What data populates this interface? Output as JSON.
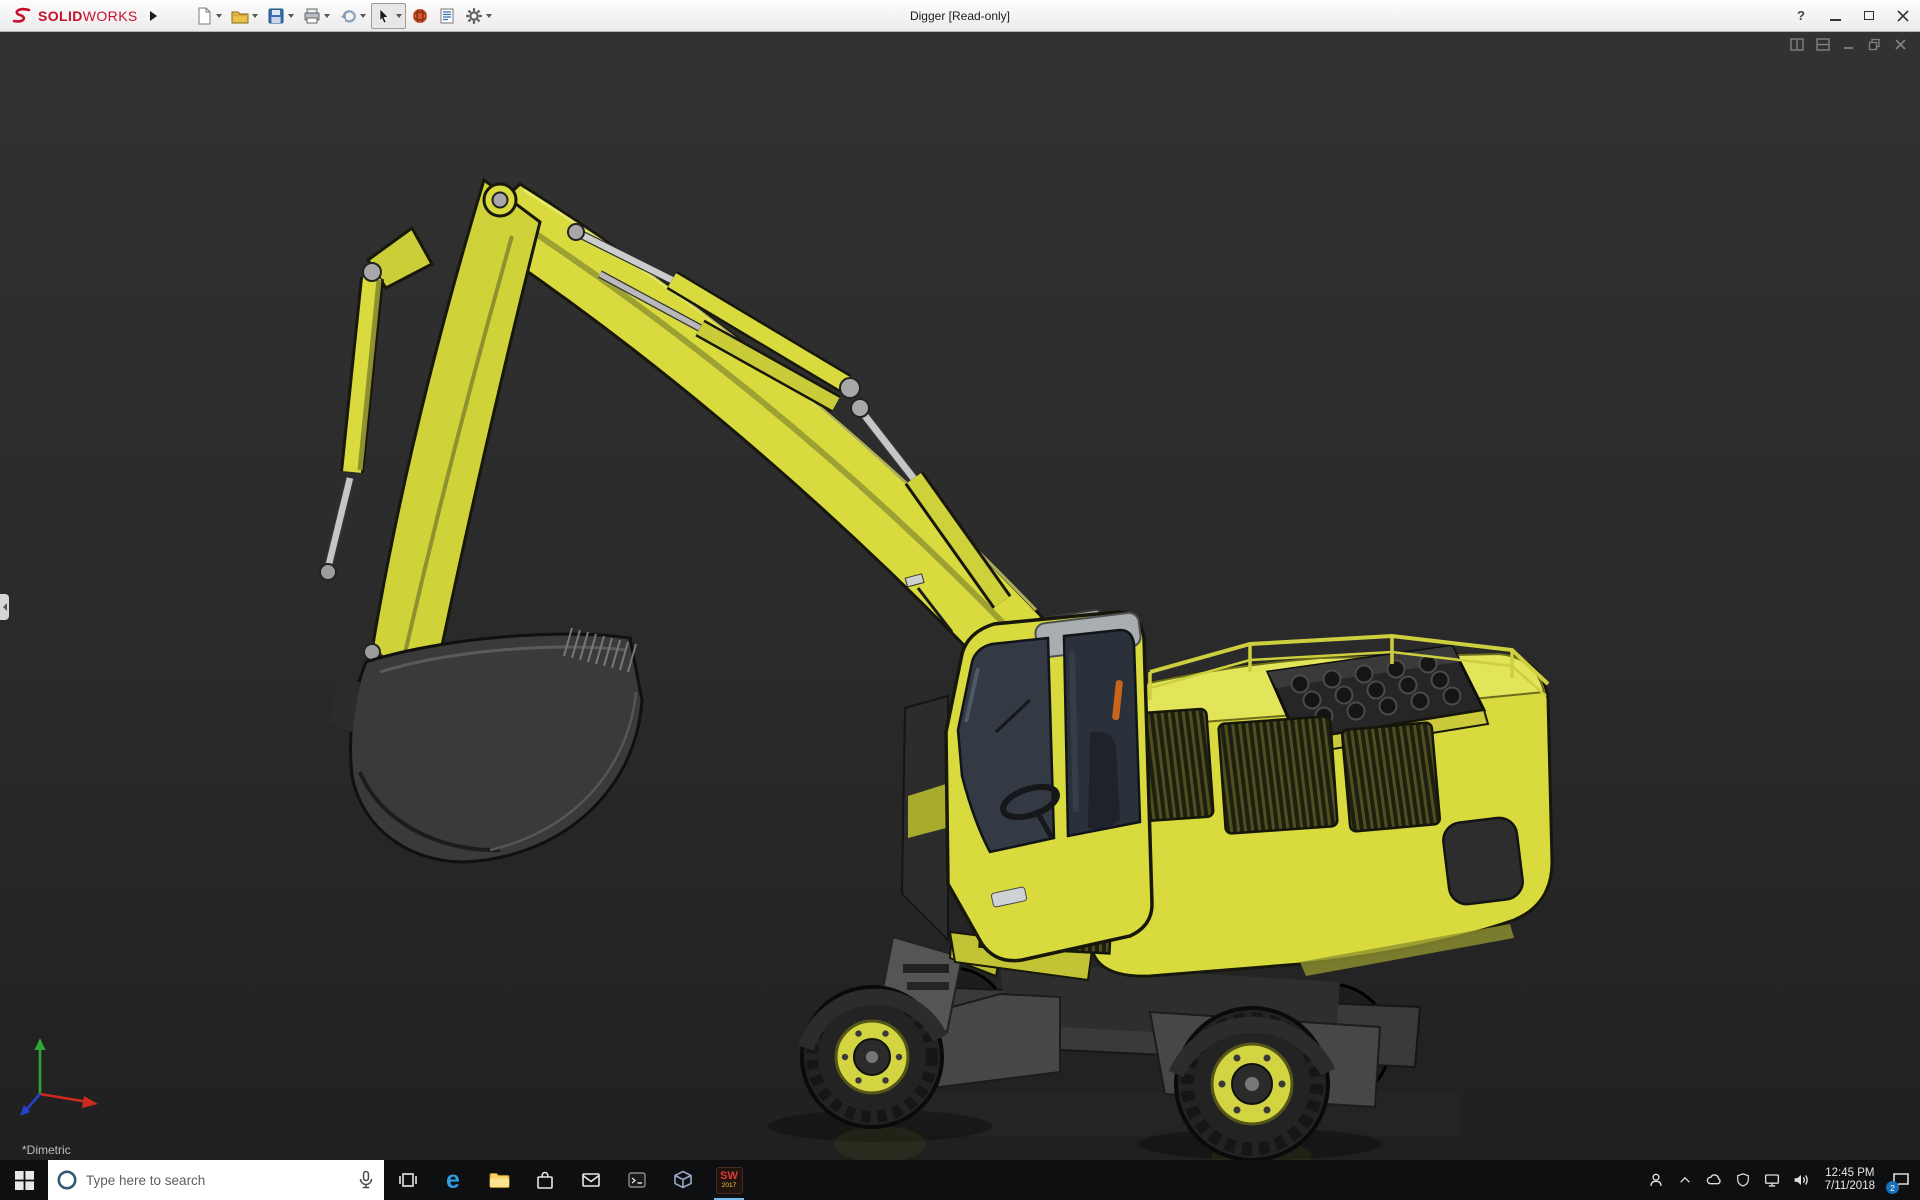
{
  "titlebar": {
    "brand": {
      "name_bold": "SOLID",
      "name_light": "WORKS"
    },
    "document_title": "Digger [Read-only]",
    "help_glyph": "?",
    "toolbar_items": [
      {
        "name": "new-document",
        "dropdown": true
      },
      {
        "name": "open",
        "dropdown": true
      },
      {
        "name": "save",
        "dropdown": true
      },
      {
        "name": "print",
        "dropdown": true
      },
      {
        "name": "undo",
        "dropdown": true
      },
      {
        "name": "select",
        "dropdown": true,
        "active": true
      },
      {
        "name": "rebuild",
        "dropdown": false
      },
      {
        "name": "file-properties",
        "dropdown": false
      },
      {
        "name": "options",
        "dropdown": true
      }
    ],
    "window_controls": [
      "help",
      "minimize",
      "maximize",
      "close"
    ]
  },
  "viewport": {
    "view_orientation_label": "*Dimetric",
    "background_color": "#2a2a2a",
    "document_controls": [
      "pane-split-vertical",
      "pane-split-horizontal",
      "doc-minimize",
      "doc-restore",
      "doc-close"
    ],
    "triad_axes": [
      "x-red",
      "y-green",
      "z-blue"
    ],
    "model": {
      "name": "Digger excavator",
      "primary_color": "#d8da3d",
      "dark_color": "#2e2e2e",
      "metal_color": "#b9b9b9",
      "accent_color": "#c8651b",
      "visible_parts": [
        "boom",
        "stick",
        "bucket",
        "hydraulic-cylinders",
        "cab",
        "upper-body",
        "engine-block",
        "side-grilles",
        "handrails",
        "undercarriage",
        "wheels"
      ]
    }
  },
  "taskbar": {
    "search": {
      "placeholder": "Type here to search"
    },
    "edge_glyph": "e",
    "pinned_apps": [
      "task-view",
      "edge",
      "file-explorer",
      "store",
      "mail",
      "terminal",
      "cad-viewer",
      "solidworks-2017"
    ],
    "solidworks_tile": {
      "line1": "SW",
      "line2": "2017"
    },
    "tray": {
      "time": "12:45 PM",
      "date": "7/11/2018",
      "notification_count": "2",
      "icons": [
        "people",
        "hidden-icons-chevron",
        "onedrive",
        "defender-shield",
        "network",
        "volume",
        "action-center"
      ]
    }
  },
  "colors": {
    "brand_red": "#c8102e",
    "model_yellow": "#d8da3d",
    "taskbar_bg": "#0e0f11",
    "edge_blue": "#2f9ce3",
    "folder_yellow": "#f9d262",
    "save_blue": "#3a6fb0"
  }
}
